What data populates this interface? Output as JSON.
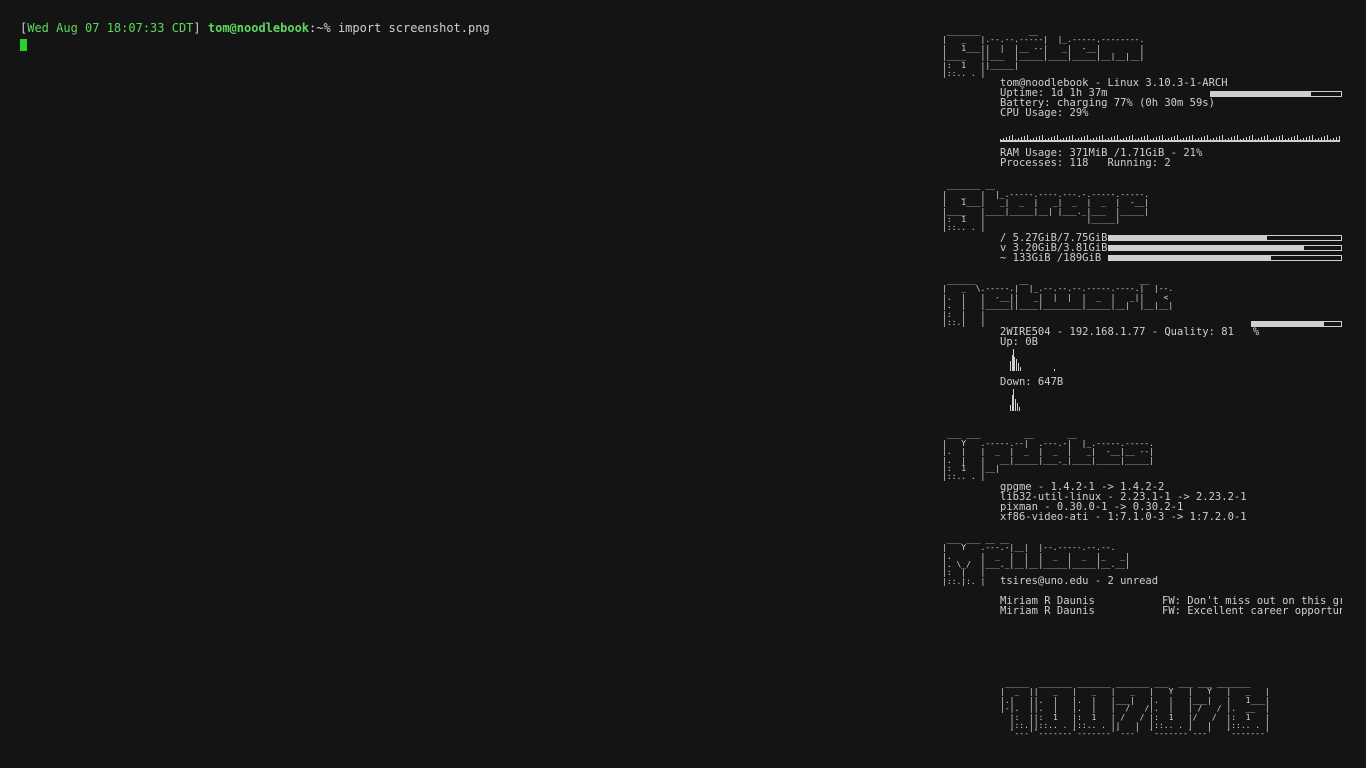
{
  "terminal": {
    "bracket_open": "[",
    "datetime": "Wed Aug 07 18:07:33 CDT",
    "bracket_close": "]",
    "user_host": "tom@noodlebook",
    "prompt_path": ":~%",
    "command": "import screenshot.png"
  },
  "system": {
    "host_line": "tom@noodlebook - Linux 3.10.3-1-ARCH",
    "uptime": "Uptime: 1d 1h 37m",
    "battery": "Battery: charging 77% (0h 30m 59s)",
    "battery_level": 0.77,
    "cpu": "CPU Usage: 29%",
    "ram": "RAM Usage: 371MiB /1.71GiB - 21%",
    "processes": "Processes: 118   Running: 2"
  },
  "storage": {
    "rows": [
      {
        "label": "/ 5.27GiB/7.75GiB",
        "level": 0.68
      },
      {
        "label": "v 3.20GiB/3.81GiB",
        "level": 0.84
      },
      {
        "label": "~ 133GiB /189GiB",
        "level": 0.7
      }
    ]
  },
  "network": {
    "wifi": "2WIRE504 - 192.168.1.77 - Quality: 81   %",
    "quality_level": 0.81,
    "up": "Up: 0B",
    "down": "Down: 647B"
  },
  "updates": {
    "items": [
      "gpgme - 1.4.2-1 -> 1.4.2-2",
      "lib32-util-linux - 2.23.1-1 -> 2.23.2-1",
      "pixman - 0.30.0-1 -> 0.30.2-1",
      "xf86-video-ati - 1:7.1.0-3 -> 1:7.2.0-1"
    ]
  },
  "mail": {
    "summary": "tsires@uno.edu - 2 unread",
    "messages": [
      {
        "from": "Miriam R Daunis",
        "subject": "FW: Don't miss out on this grea"
      },
      {
        "from": "Miriam R Daunis",
        "subject": "FW: Excellent career opportunit"
      }
    ]
  }
}
